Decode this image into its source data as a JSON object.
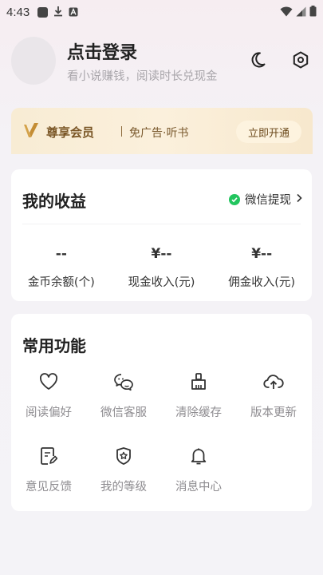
{
  "status_bar": {
    "time": "4:43"
  },
  "header": {
    "title": "点击登录",
    "subtitle": "看小说赚钱，阅读时长兑现金"
  },
  "vip": {
    "title": "尊享会员",
    "description": "免广告·听书",
    "button": "立即开通"
  },
  "earnings": {
    "title": "我的收益",
    "withdraw_label": "微信提现",
    "stats": [
      {
        "value": "--",
        "label": "金币余额(个)"
      },
      {
        "value": "¥--",
        "label": "现金收入(元)"
      },
      {
        "value": "¥--",
        "label": "佣金收入(元)"
      }
    ]
  },
  "functions": {
    "title": "常用功能",
    "items": [
      {
        "label": "阅读偏好",
        "icon": "heart-icon"
      },
      {
        "label": "微信客服",
        "icon": "wechat-icon"
      },
      {
        "label": "清除缓存",
        "icon": "broom-icon"
      },
      {
        "label": "版本更新",
        "icon": "cloud-upload-icon"
      },
      {
        "label": "意见反馈",
        "icon": "feedback-icon"
      },
      {
        "label": "我的等级",
        "icon": "level-badge-icon"
      },
      {
        "label": "消息中心",
        "icon": "bell-icon"
      }
    ]
  },
  "colors": {
    "accent_green": "#22c55e",
    "vip_gold": "#7a5626",
    "muted_text": "#8e8c90"
  }
}
